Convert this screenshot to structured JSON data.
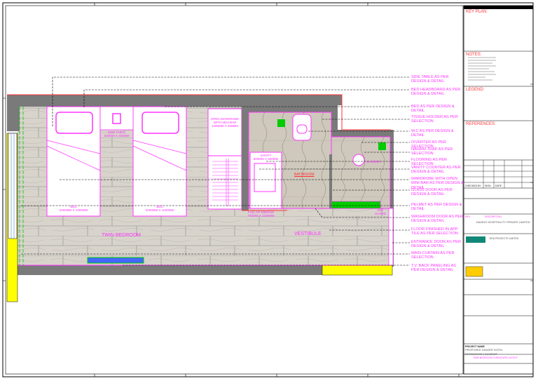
{
  "drawing": {
    "rooms": {
      "twin_bedroom": "TWIN BEDROOM",
      "vestibule": "VESTIBULE",
      "bathroom": "BATHROOM",
      "shower": "SHOWER"
    },
    "labels": {
      "bed1": "BED\n2000MM X 1000MM",
      "bed2": "BED\n2000MM X 1000MM",
      "side_table": "SIDE TABLE\n500MM X 400MM",
      "wardrobe": "OPEN WARDROBE\nWITH MINI BAR\n1000MM X 600MM",
      "vanity": "VANITY\n800MM X 550MM",
      "full_mirror": "FULL HT MIRROR\n700MM X 2200MM",
      "key_guard": "KEY\nGUARD"
    },
    "callouts": [
      "SIDE TABLE AS PER DESIGN & DETAIL",
      "BED HEADBOARD AS PER DESIGN & DETAIL",
      "BED AS PER DESIGN & DETAIL",
      "TISSUE HOLDER AS PER SELECTION",
      "W.C AS PER DESIGN & DETAIL",
      "DIVERTER AS PER SELECTION",
      "NAHANI TRAP AS PER SELECTION",
      "FLOORING AS PER SELECTION",
      "VANITY COUNTER AS PER DESIGN & DETAIL",
      "WARDROBE WITH OPEN MINI BAR AS PER DESIGN & DETAIL",
      "GLASS DOOR AS PER DESIGN & DETAIL",
      "PELMET AS PER DESIGN & DETAIL",
      "WASHROOM DOOR AS PER DESIGN & DETAIL",
      "FLOOR FINISHED IN APP. TILE AS PER SELECTION",
      "ENTRANCE DOOR AS PER DESIGN & DETAIL",
      "MAIN CURTAIN AS PER SELECTION",
      "T.V. BACK PANELING AS PER DESIGN & DETAIL"
    ]
  },
  "title_block": {
    "key_plan": "KEY PLAN:",
    "notes": "NOTES:",
    "legend": "LEGEND:",
    "references": "REFERENCES:",
    "checked_by": "CHECKED BY",
    "sign": "SIGN",
    "date": "DATE",
    "rev": "REV",
    "description": "DESCRIPTION",
    "client": "DAISHO HOSPITALITY PRIVATE LIMITED",
    "project_label": "PROJECT NAME",
    "project_name": "PROPOSED GINGER HOTEL\nEKTANAGAR | GUJARAT",
    "title_text": "TWIN BEDROOM FURNITURE LAYOUT",
    "consultant": "TATA PROJECTS LIMITED"
  },
  "colors": {
    "accent": "#ff33ff",
    "wall": "#7a7a7a",
    "floor": "#d8d4cc",
    "highlight": "#00cc00",
    "red": "#ff3333",
    "yellow": "#ffff00"
  }
}
